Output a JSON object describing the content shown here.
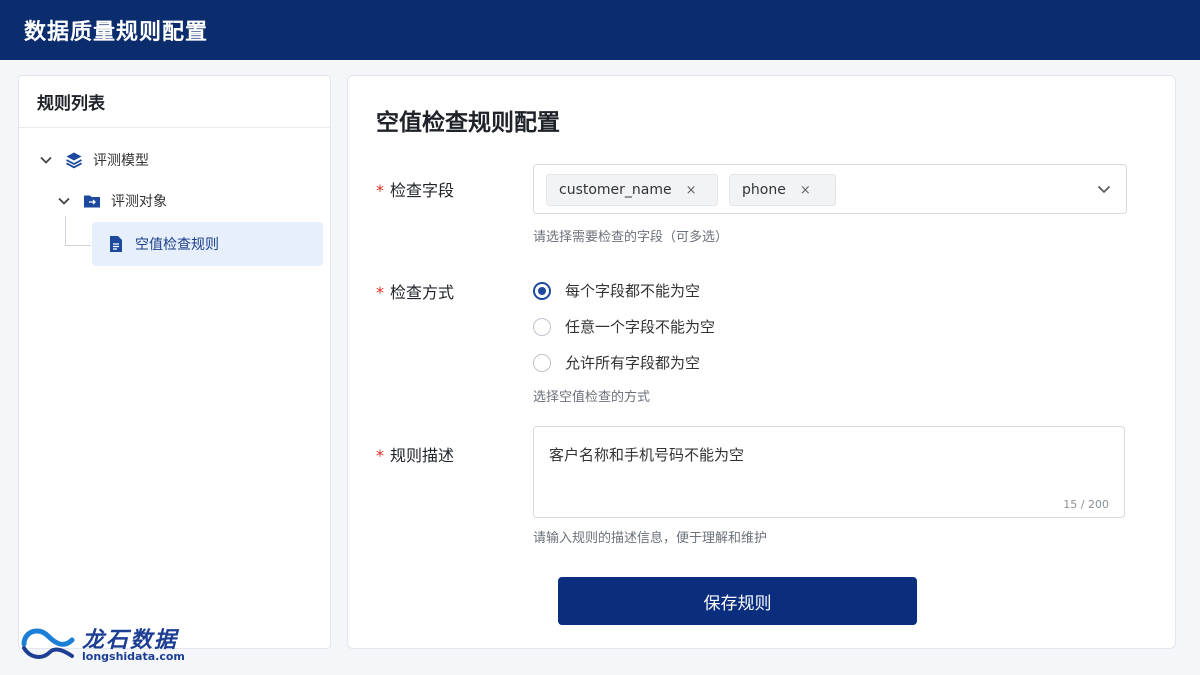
{
  "header": {
    "title": "数据质量规则配置"
  },
  "sidebar": {
    "title": "规则列表",
    "tree": {
      "model": "评测模型",
      "object": "评测对象",
      "rule": "空值检查规则"
    }
  },
  "form": {
    "title": "空值检查规则配置",
    "fields": {
      "label": "检查字段",
      "required_mark": "*",
      "tags": [
        "customer_name",
        "phone"
      ],
      "remove_glyph": "×",
      "hint": "请选择需要检查的字段（可多选）"
    },
    "method": {
      "label": "检查方式",
      "required_mark": "*",
      "options": [
        "每个字段都不能为空",
        "任意一个字段不能为空",
        "允许所有字段都为空"
      ],
      "selected_index": 0,
      "hint": "选择空值检查的方式"
    },
    "description": {
      "label": "规则描述",
      "required_mark": "*",
      "value": "客户名称和手机号码不能为空",
      "counter": "15 / 200",
      "hint": "请输入规则的描述信息，便于理解和维护"
    },
    "save_label": "保存规则"
  },
  "brand": {
    "name": "龙石数据",
    "url": "longshidata.com"
  },
  "colors": {
    "header_bg": "#0b2d6e",
    "accent": "#1d4a9e",
    "button": "#0b2d7e",
    "selected_bg": "#e6effb",
    "required": "#d93026"
  }
}
